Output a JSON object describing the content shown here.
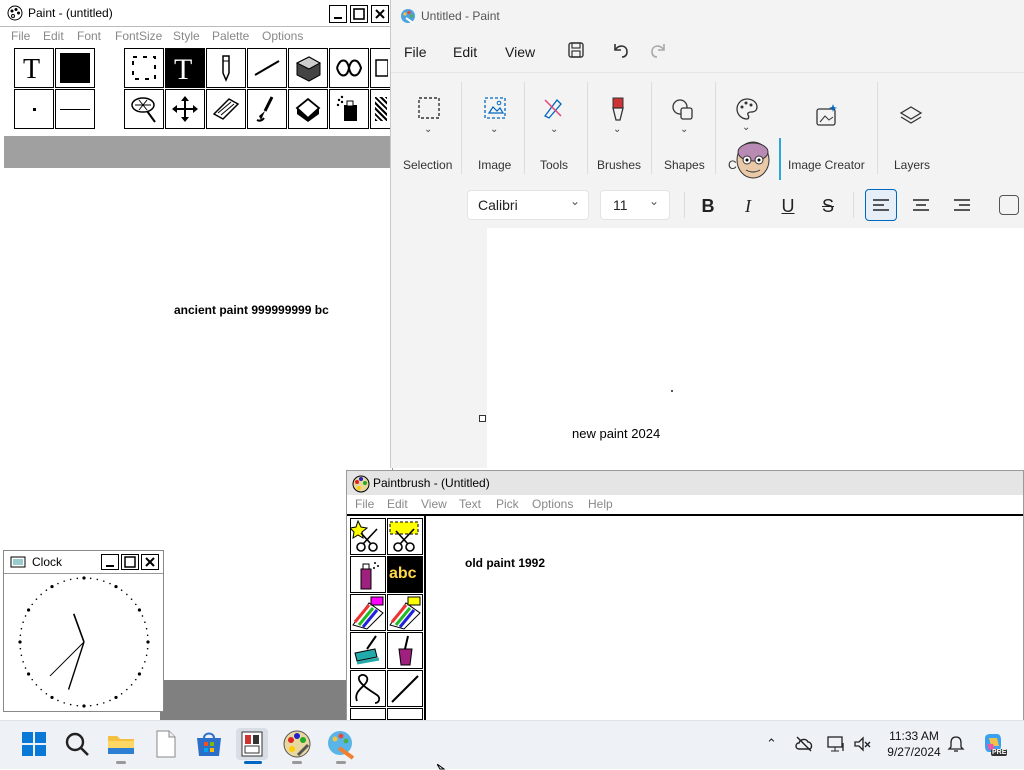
{
  "old_paint": {
    "title": "Paint - (untitled)",
    "menu": [
      "File",
      "Edit",
      "Font",
      "FontSize",
      "Style",
      "Palette",
      "Options"
    ],
    "canvas_text": "ancient paint 999999999 bc"
  },
  "clock": {
    "title": "Clock",
    "hour_hand_deg": 10,
    "minute_hand_deg": 198,
    "second_hand_deg": 225
  },
  "new_paint": {
    "title": "Untitled - Paint",
    "menu": [
      "File",
      "Edit",
      "View"
    ],
    "ribbon": [
      "Selection",
      "Image",
      "Tools",
      "Brushes",
      "Shapes",
      "C",
      "Image Creator",
      "Layers"
    ],
    "font_name": "Calibri",
    "font_size": "11",
    "canvas_text": "new paint 2024"
  },
  "paintbrush": {
    "title": "Paintbrush - (Untitled)",
    "menu": [
      "File",
      "Edit",
      "View",
      "Text",
      "Pick",
      "Options",
      "Help"
    ],
    "abc_label": "abc",
    "canvas_text": "old paint 1992"
  },
  "taskbar": {
    "time": "11:33 AM",
    "date": "9/27/2024",
    "copilot_badge": "PRE"
  },
  "colors": {
    "accent": "#0067c0",
    "taskbar_bg": "#eef1f6",
    "old_gray": "#a0a0a0"
  }
}
